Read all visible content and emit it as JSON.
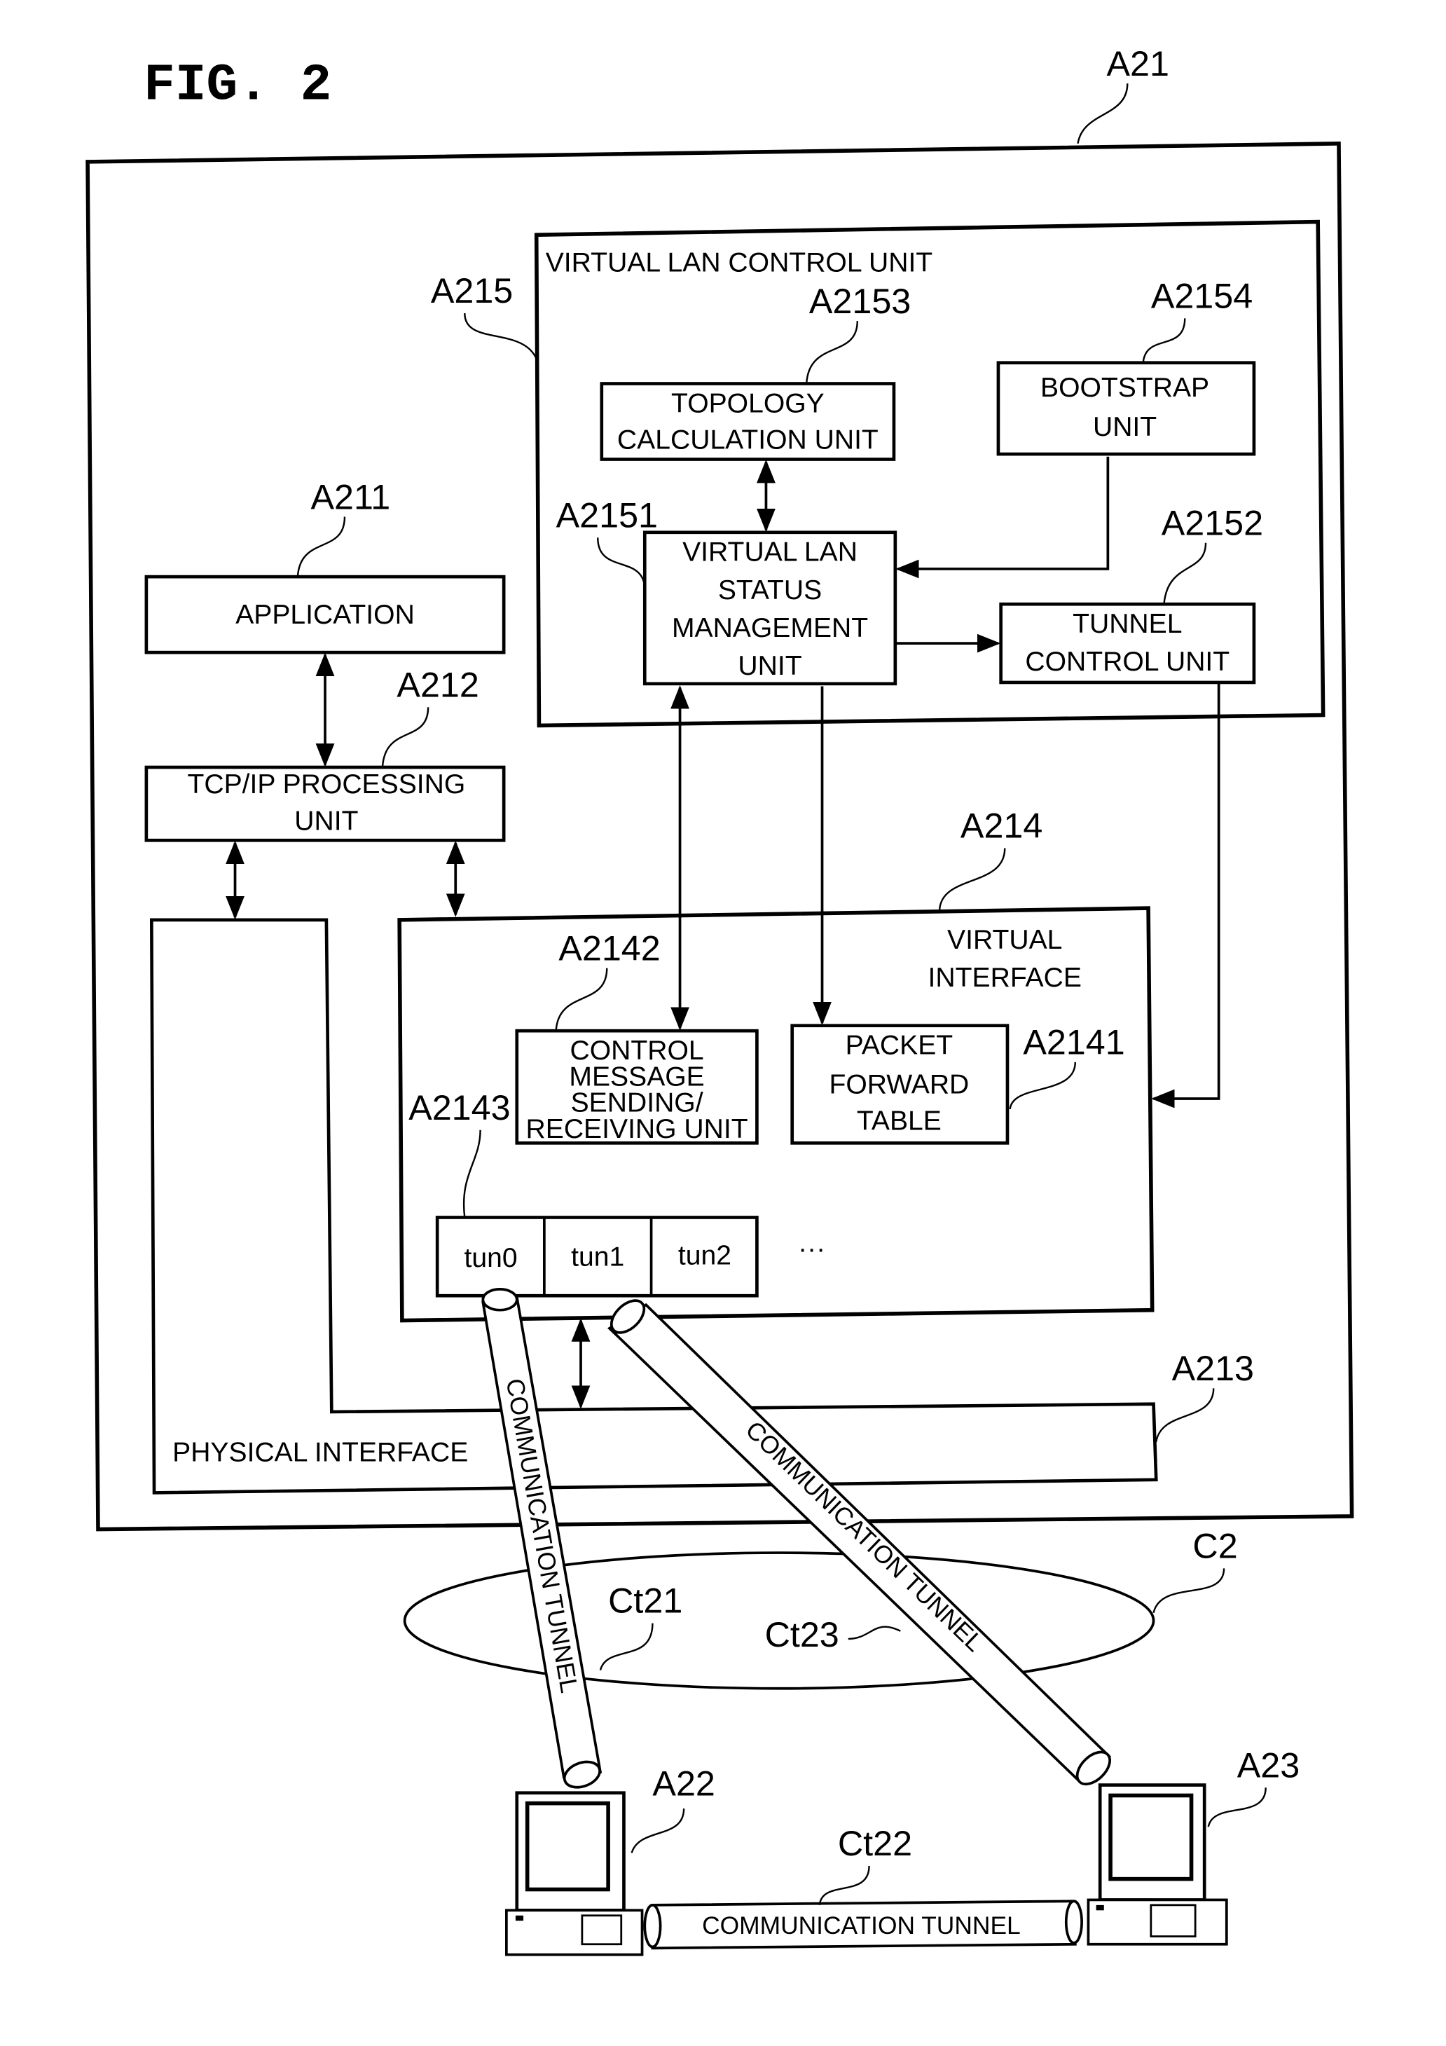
{
  "figure": {
    "title": "FIG. 2"
  },
  "refs": {
    "A21": "A21",
    "A215": "A215",
    "A2153": "A2153",
    "A2154": "A2154",
    "A211": "A211",
    "A2151": "A2151",
    "A2152": "A2152",
    "A212": "A212",
    "A214": "A214",
    "A2142": "A2142",
    "A2141": "A2141",
    "A2143": "A2143",
    "A213": "A213",
    "C2": "C2",
    "Ct21": "Ct21",
    "Ct23": "Ct23",
    "A22": "A22",
    "A23": "A23",
    "Ct22": "Ct22"
  },
  "blocks": {
    "virtual_lan_control": "VIRTUAL LAN CONTROL UNIT",
    "topology": [
      "TOPOLOGY",
      "CALCULATION UNIT"
    ],
    "bootstrap": [
      "BOOTSTRAP",
      "UNIT"
    ],
    "vlan_status": [
      "VIRTUAL LAN",
      "STATUS",
      "MANAGEMENT",
      "UNIT"
    ],
    "tunnel_control": [
      "TUNNEL",
      "CONTROL UNIT"
    ],
    "application": "APPLICATION",
    "tcpip": [
      "TCP/IP PROCESSING",
      "UNIT"
    ],
    "virtual_interface": [
      "VIRTUAL",
      "INTERFACE"
    ],
    "control_message": [
      "CONTROL",
      "MESSAGE",
      "SENDING/",
      "RECEIVING UNIT"
    ],
    "packet_forward": [
      "PACKET",
      "FORWARD",
      "TABLE"
    ],
    "physical_interface": "PHYSICAL INTERFACE",
    "tunnels": [
      "tun0",
      "tun1",
      "tun2"
    ],
    "ellipsis": "···"
  },
  "tunnels": {
    "ct21_label": "COMMUNICATION TUNNEL",
    "ct23_label": "COMMUNICATION TUNNEL",
    "ct22_label": "COMMUNICATION TUNNEL"
  }
}
